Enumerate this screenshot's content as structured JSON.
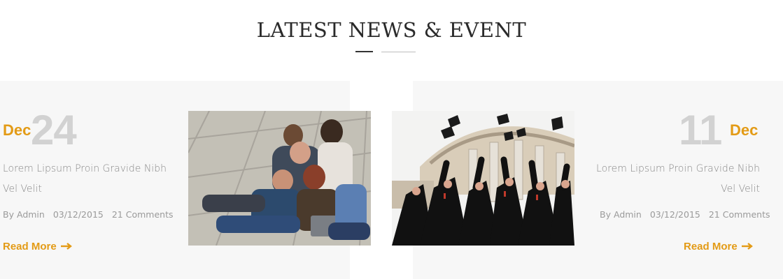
{
  "section": {
    "title": "LATEST NEWS & EVENT"
  },
  "posts": [
    {
      "month": "Dec",
      "day": "24",
      "excerpt": "Lorem Lipsum Proin Gravide Nibh Vel Velit",
      "meta_by": "By",
      "meta_author": "Admin",
      "meta_date": "03/12/2015",
      "meta_comments": "21 Comments",
      "read_more": "Read More",
      "image": "students-studying-laptop"
    },
    {
      "month": "Dec",
      "day": "11",
      "excerpt": "Lorem Lipsum Proin Gravide Nibh Vel Velit",
      "meta_by": "By",
      "meta_author": "Admin",
      "meta_date": "03/12/2015",
      "meta_comments": "21 Comments",
      "read_more": "Read More",
      "image": "graduation-caps-toss"
    }
  ],
  "colors": {
    "accent": "#e39b16",
    "day_number": "#d2d2d2",
    "card_bg": "#f7f7f7",
    "text_muted": "#8a8a8a"
  }
}
